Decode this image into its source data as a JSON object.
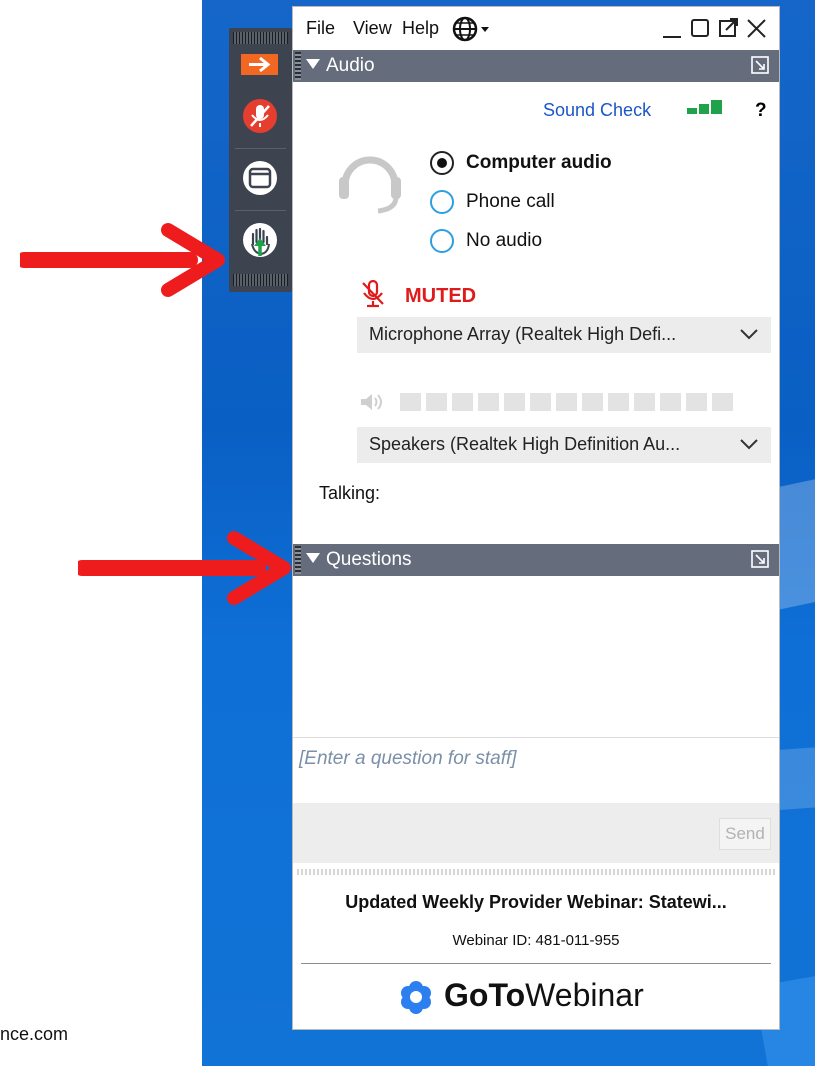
{
  "page_footer_text": "nce.com",
  "menu": {
    "file": "File",
    "view": "View",
    "help": "Help"
  },
  "audio": {
    "header": "Audio",
    "sound_check": "Sound Check",
    "help_mark": "?",
    "options": [
      {
        "label": "Computer audio",
        "selected": true
      },
      {
        "label": "Phone call",
        "selected": false
      },
      {
        "label": "No audio",
        "selected": false
      }
    ],
    "muted_label": "MUTED",
    "microphone": "Microphone Array (Realtek High Defi...",
    "speakers": "Speakers (Realtek High Definition Au...",
    "talking_label": "Talking:"
  },
  "questions": {
    "header": "Questions",
    "placeholder": "[Enter a question for staff]",
    "send_label": "Send"
  },
  "webinar": {
    "title": "Updated Weekly Provider Webinar: Statewi...",
    "id_text": "Webinar ID: 481-011-955",
    "brand_bold": "GoTo",
    "brand_light": "Webinar"
  },
  "colors": {
    "header_bg": "#656d7d",
    "accent_orange": "#f26722",
    "muted_red": "#e01b1b",
    "link_blue": "#1a56c8",
    "signal_green": "#1fa34a",
    "radio_blue": "#2b9fe0",
    "annotation_red": "#ee1c1c"
  }
}
